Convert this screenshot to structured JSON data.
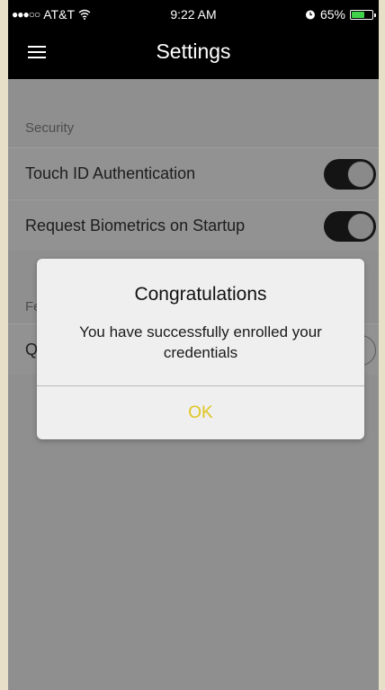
{
  "status_bar": {
    "carrier": "AT&T",
    "signal": "●●●○○",
    "time": "9:22 AM",
    "battery": "65%",
    "battery_level": 0.65,
    "battery_color": "#3fd14a"
  },
  "nav": {
    "title": "Settings",
    "menu_icon": "hamburger-menu-icon"
  },
  "sections": {
    "security": {
      "header": "Security",
      "items": [
        {
          "label": "Touch ID Authentication",
          "enabled": true
        },
        {
          "label": "Request Biometrics on Startup",
          "enabled": true
        }
      ]
    },
    "partial": {
      "header": "Fe",
      "items": [
        {
          "label": "Q",
          "enabled": false
        }
      ]
    }
  },
  "dialog": {
    "title": "Congratulations",
    "message": "You have successfully enrolled your credentials",
    "ok_label": "OK",
    "ok_color": "#e0c520"
  }
}
